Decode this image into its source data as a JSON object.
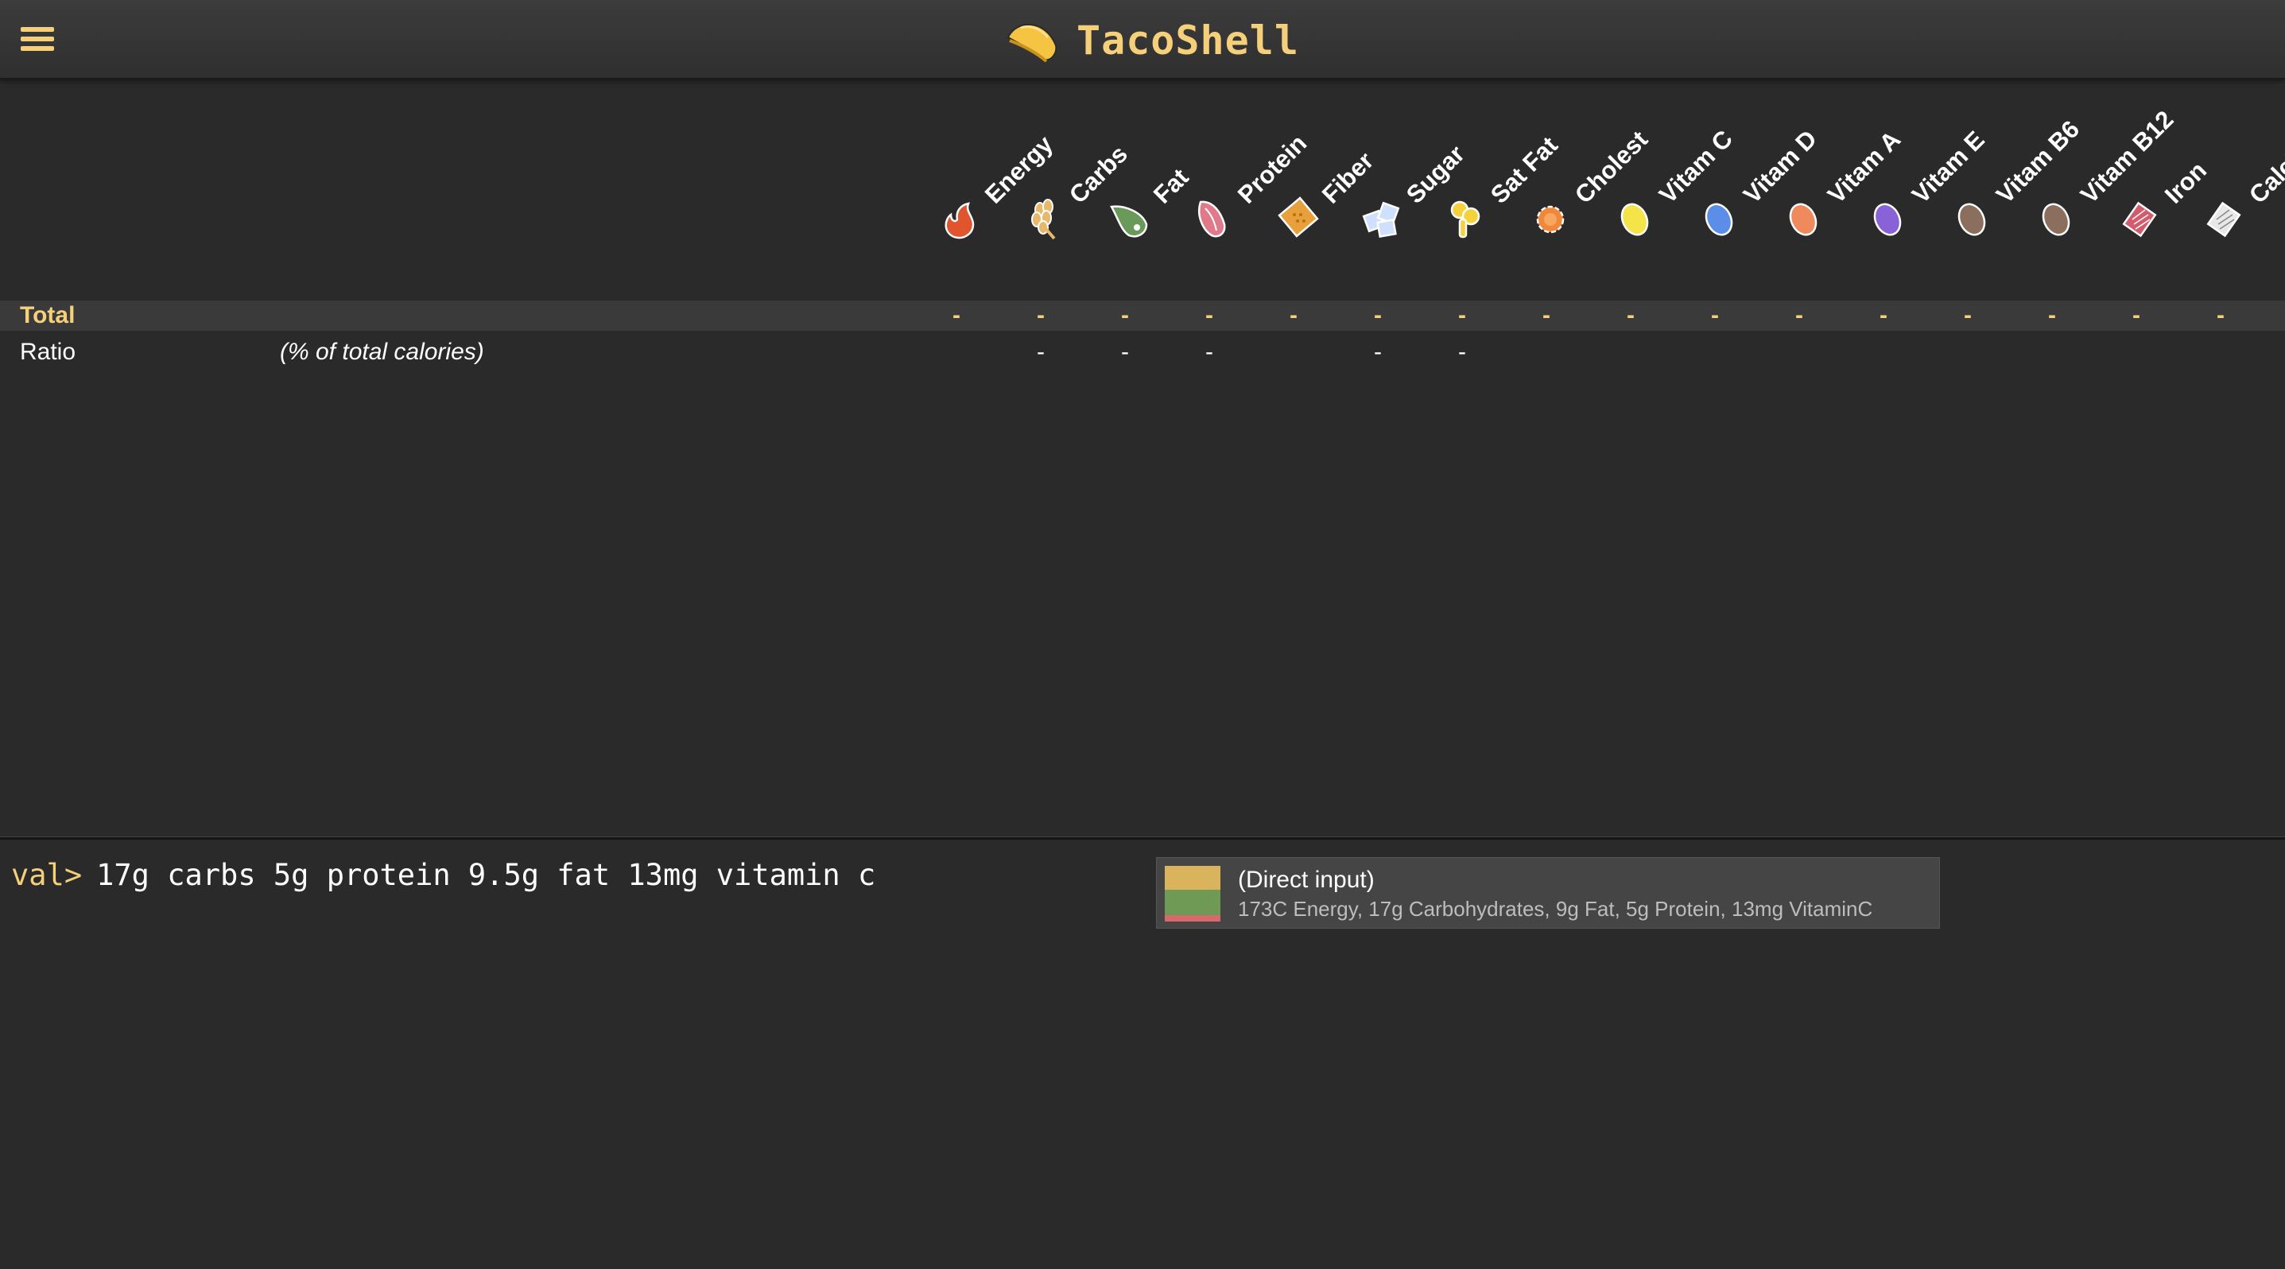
{
  "app": {
    "title": "TacoShell",
    "menu_icon": "hamburger-icon",
    "logo_icon": "taco-icon",
    "accent_color": "#f5cf7a"
  },
  "nutrients": [
    {
      "label": "Energy",
      "icon": "flame-icon"
    },
    {
      "label": "Carbs",
      "icon": "wheat-icon"
    },
    {
      "label": "Fat",
      "icon": "oil-drop-icon"
    },
    {
      "label": "Protein",
      "icon": "meat-icon"
    },
    {
      "label": "Fiber",
      "icon": "cracker-icon"
    },
    {
      "label": "Sugar",
      "icon": "sugar-cubes-icon"
    },
    {
      "label": "Sat Fat",
      "icon": "butter-icon"
    },
    {
      "label": "Cholest",
      "icon": "egg-yolk-icon"
    },
    {
      "label": "Vitam C",
      "icon": "yellow-pill-icon"
    },
    {
      "label": "Vitam D",
      "icon": "blue-pill-icon"
    },
    {
      "label": "Vitam A",
      "icon": "orange-pill-icon"
    },
    {
      "label": "Vitam E",
      "icon": "purple-pill-icon"
    },
    {
      "label": "Vitam B6",
      "icon": "brown-pill-icon"
    },
    {
      "label": "Vitam B12",
      "icon": "brown-pill-icon"
    },
    {
      "label": "Iron",
      "icon": "iron-tablet-icon"
    },
    {
      "label": "Calci",
      "icon": "calcium-tablet-icon"
    }
  ],
  "table": {
    "total_label": "Total",
    "total_values": [
      "-",
      "-",
      "-",
      "-",
      "-",
      "-",
      "-",
      "-",
      "-",
      "-",
      "-",
      "-",
      "-",
      "-",
      "-",
      "-"
    ],
    "ratio_label": "Ratio",
    "ratio_note": "(% of total calories)",
    "ratio_values": [
      "",
      "-",
      "-",
      "-",
      "",
      "-",
      "-",
      "",
      "",
      "",
      "",
      "",
      "",
      "",
      "",
      ""
    ]
  },
  "console": {
    "prompt": "val>",
    "input": "17g carbs 5g protein 9.5g fat 13mg vitamin c"
  },
  "result": {
    "title": "(Direct input)",
    "summary": "173C Energy, 17g Carbohydrates, 9g Fat, 5g Protein, 13mg VitaminC",
    "swatch_colors": [
      "#d9b45c",
      "#6e9a55",
      "#d9686c"
    ]
  }
}
